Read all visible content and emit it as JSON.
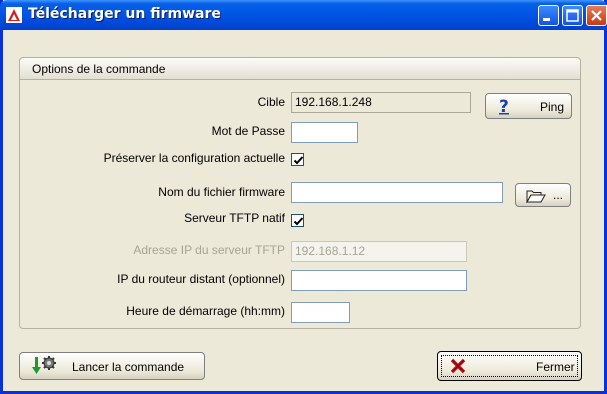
{
  "window": {
    "title": "Télécharger un firmware",
    "colors": {
      "titlebar": "#0058e6",
      "close_button": "#c43a13",
      "background": "#ece9d8"
    }
  },
  "group": {
    "header": "Options de la commande"
  },
  "form": {
    "target_label": "Cible",
    "target_value": "192.168.1.248",
    "password_label": "Mot de Passe",
    "password_value": "",
    "preserve_label": "Préserver la configuration actuelle",
    "preserve_checked": true,
    "firmware_label": "Nom du fichier firmware",
    "firmware_value": "",
    "tftp_native_label": "Serveur TFTP natif",
    "tftp_native_checked": true,
    "tftp_ip_label": "Adresse IP du serveur TFTP",
    "tftp_ip_value": "192.168.1.12",
    "router_ip_label": "IP du routeur distant (optionnel)",
    "router_ip_value": "",
    "start_time_label": "Heure de démarrage (hh:mm)",
    "start_time_value": ""
  },
  "buttons": {
    "ping": "Ping",
    "browse": "...",
    "launch": "Lancer la commande",
    "close": "Fermer"
  },
  "icons": {
    "title": "app-icon",
    "ping": "help-icon",
    "browse": "folder-open-icon",
    "launch": "run-gear-icon",
    "close": "red-x-icon"
  }
}
